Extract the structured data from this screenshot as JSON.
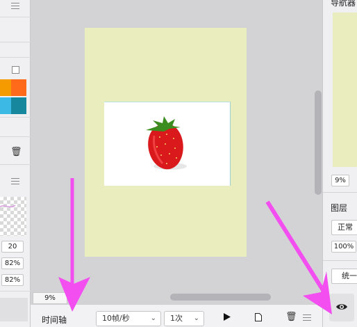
{
  "left_panel": {
    "menu_icon": "hamburger-icon",
    "swatch_colors": [
      "#f59b00",
      "#ff6a1a",
      "#3db9e6",
      "#17879d"
    ],
    "delete_icon": "trash-icon",
    "values": [
      "20",
      "82%",
      "82%"
    ]
  },
  "canvas": {
    "zoom": "9%",
    "page_color": "#eaedbd",
    "image": "strawberry"
  },
  "timeline": {
    "label": "时间轴",
    "fps": "10帧/秒",
    "repeat": "1次",
    "play_icon": "play-icon",
    "new_frame_icon": "document-icon",
    "delete_icon": "trash-icon",
    "menu_icon": "hamburger-icon"
  },
  "right_panel": {
    "navigator_title": "导航器",
    "navigator_zoom": "9%",
    "layers_title": "图层",
    "blend_mode": "正常",
    "opacity": "100%",
    "unify_button": "统一",
    "eye_icon": "eye-icon"
  },
  "annotations": {
    "arrow_color": "#f24ef0"
  }
}
